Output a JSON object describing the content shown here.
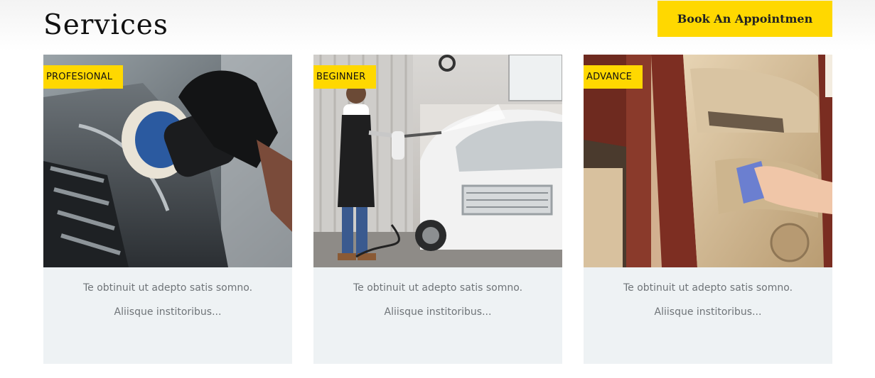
{
  "header": {
    "title": "Services",
    "cta_label": "Book An Appointmen"
  },
  "colors": {
    "accent": "#ffd800",
    "card_body": "#eef2f4",
    "body_text": "#6f7478"
  },
  "cards": [
    {
      "badge": "PROFESIONAL",
      "text": "Te obtinuit ut adepto satis somno. Aliisque institoribus..."
    },
    {
      "badge": "BEGINNER",
      "text": "Te obtinuit ut adepto satis somno. Aliisque institoribus..."
    },
    {
      "badge": "ADVANCE",
      "text": "Te obtinuit ut adepto satis somno. Aliisque institoribus..."
    }
  ]
}
